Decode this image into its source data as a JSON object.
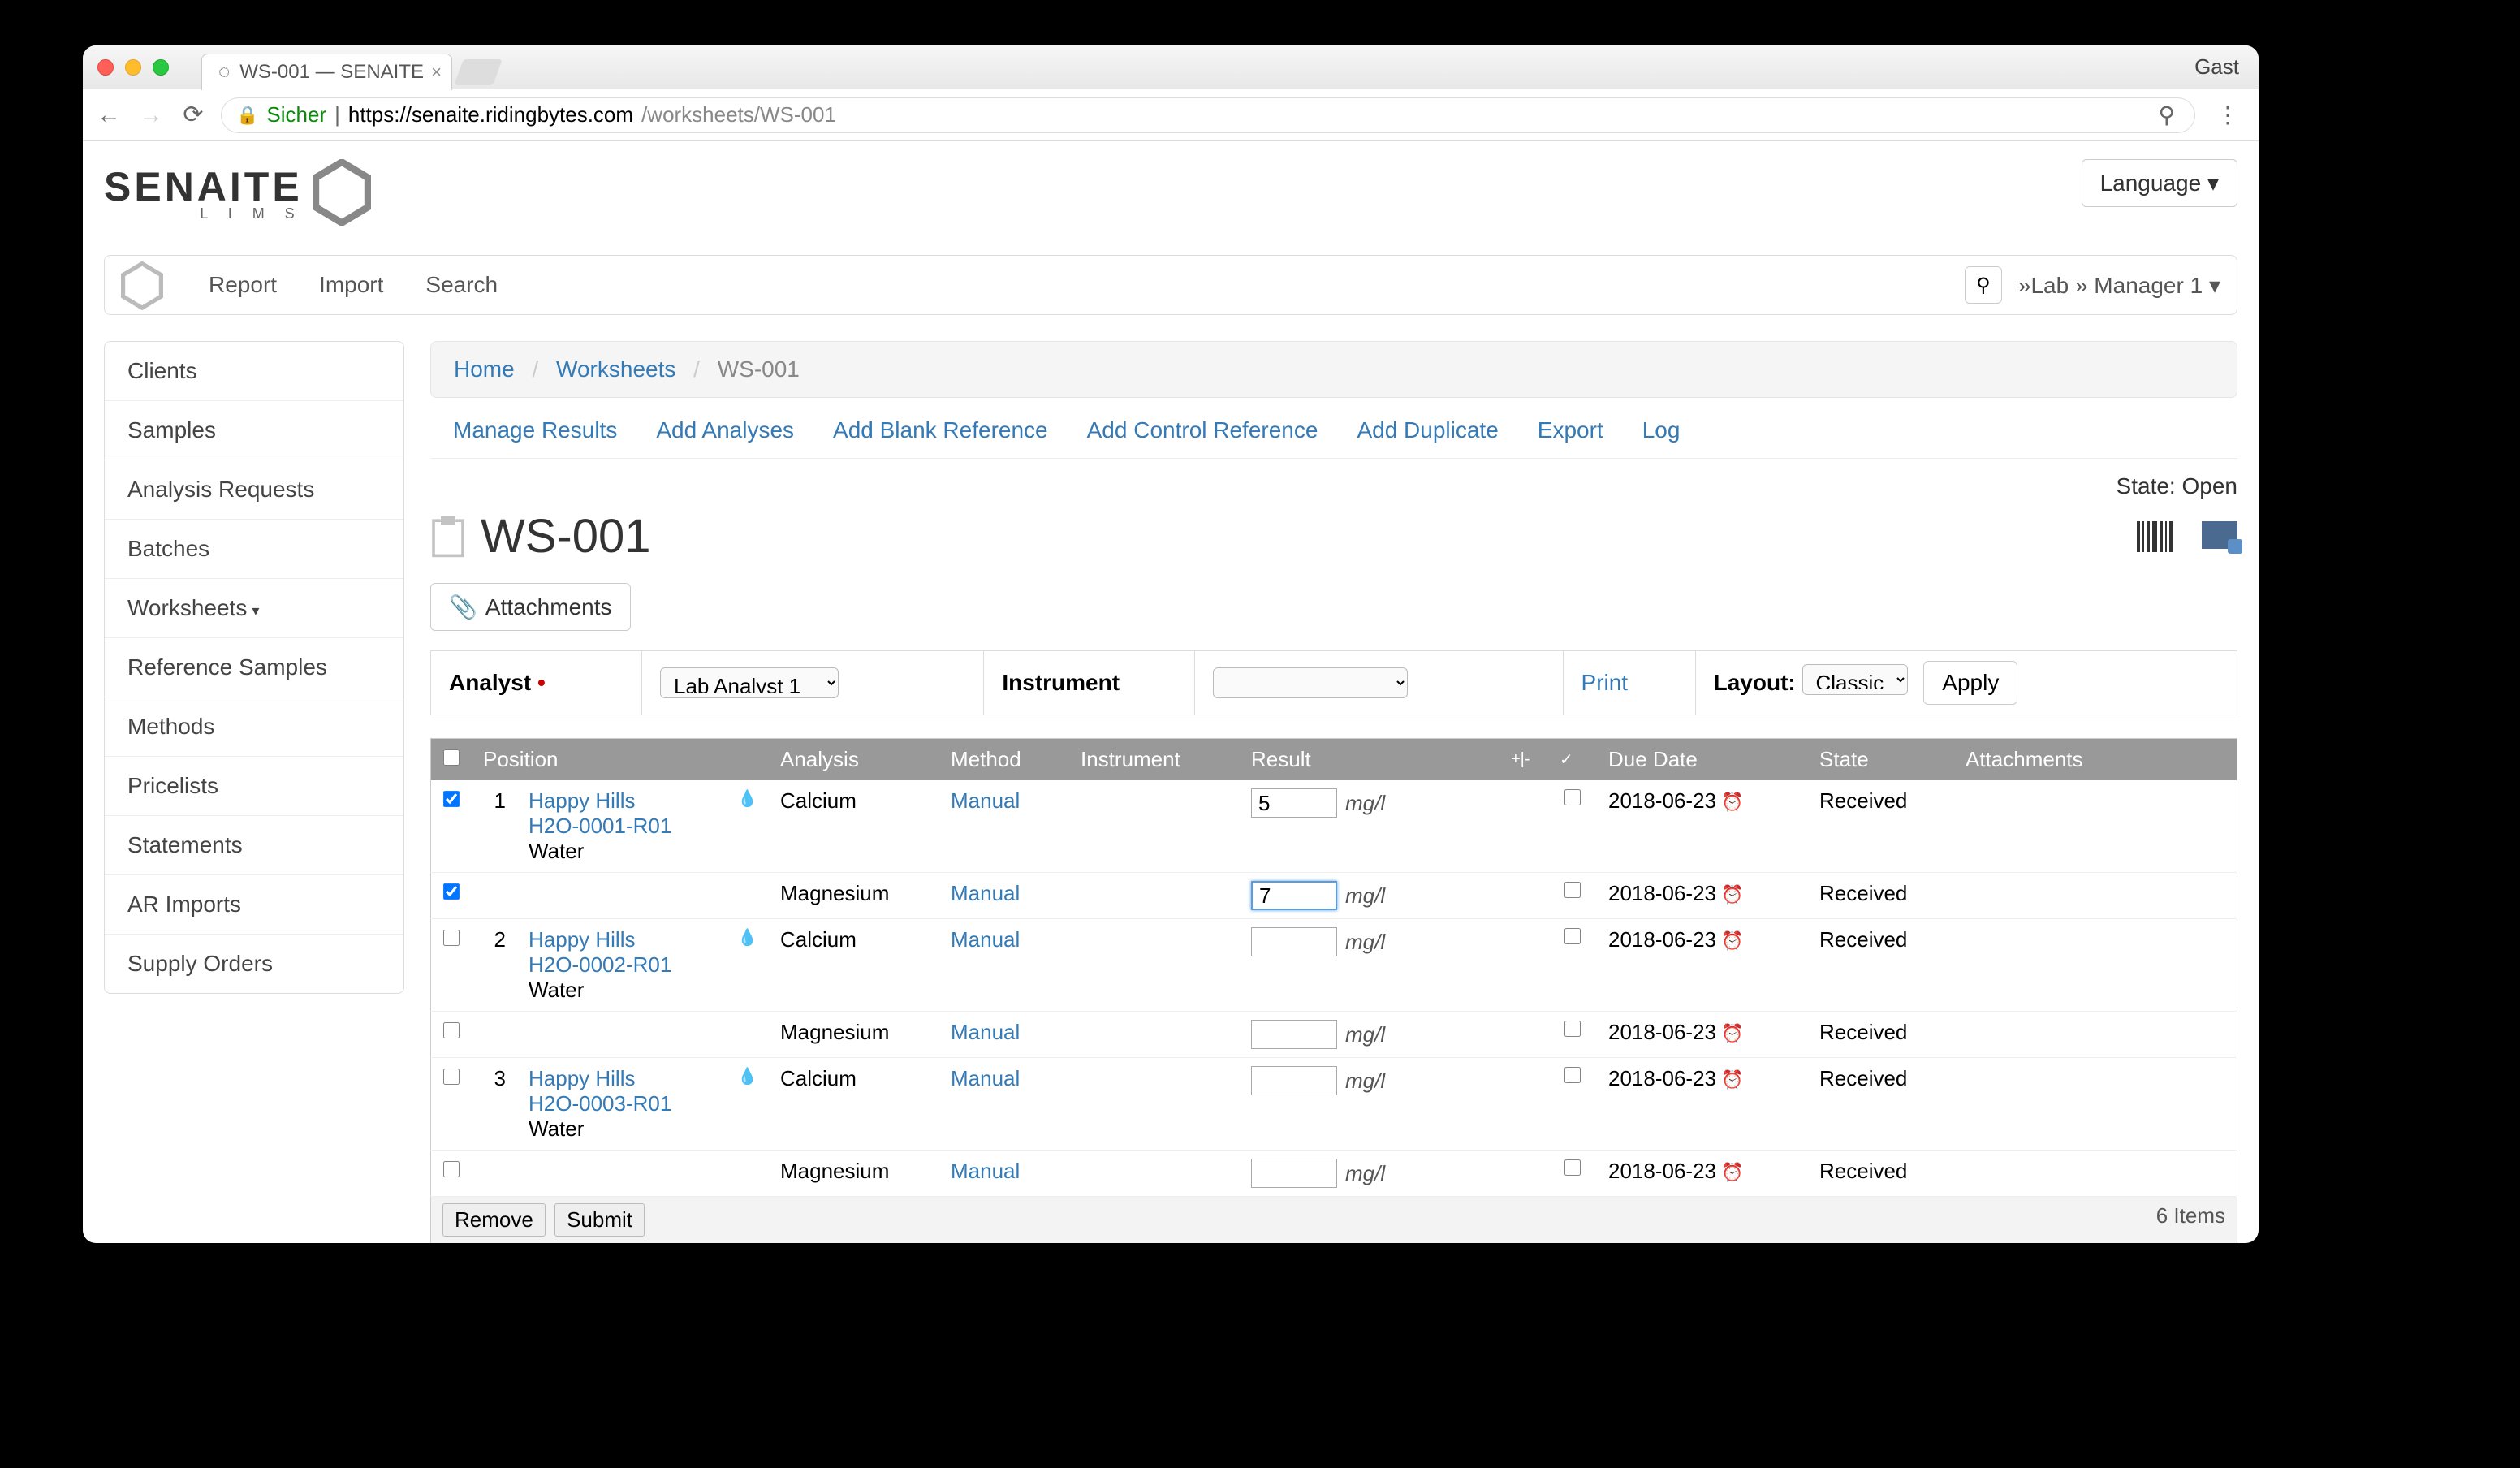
{
  "browser": {
    "tab_title": "WS-001 — SENAITE",
    "profile": "Gast",
    "secure_label": "Sicher",
    "url_host": "https://senaite.ridingbytes.com",
    "url_path": "/worksheets/WS-001"
  },
  "header": {
    "logo_text": "SENAITE",
    "logo_sub": "L I M S",
    "language_btn": "Language"
  },
  "navbar": {
    "links": [
      "Report",
      "Import",
      "Search"
    ],
    "user": "»Lab » Manager 1"
  },
  "sidebar": {
    "items": [
      "Clients",
      "Samples",
      "Analysis Requests",
      "Batches",
      "Worksheets",
      "Reference Samples",
      "Methods",
      "Pricelists",
      "Statements",
      "AR Imports",
      "Supply Orders"
    ]
  },
  "breadcrumb": {
    "home": "Home",
    "worksheets": "Worksheets",
    "current": "WS-001"
  },
  "action_tabs": [
    "Manage Results",
    "Add Analyses",
    "Add Blank Reference",
    "Add Control Reference",
    "Add Duplicate",
    "Export",
    "Log"
  ],
  "state_label": "State:",
  "state_value": "Open",
  "page_title": "WS-001",
  "attachments_btn": "Attachments",
  "controls": {
    "analyst_label": "Analyst",
    "analyst_value": "Lab Analyst 1",
    "instrument_label": "Instrument",
    "instrument_value": "",
    "print": "Print",
    "layout_label": "Layout:",
    "layout_value": "Classic",
    "apply": "Apply"
  },
  "table": {
    "headers": {
      "position": "Position",
      "analysis": "Analysis",
      "method": "Method",
      "instrument": "Instrument",
      "result": "Result",
      "shift": "+|-",
      "tick": "✓",
      "due": "Due Date",
      "state": "State",
      "attachments": "Attachments"
    },
    "rows": [
      {
        "checked": true,
        "pos": "1",
        "client": "Happy Hills",
        "sample_id": "H2O-0001-R01",
        "type": "Water",
        "analysis": "Calcium",
        "method": "Manual",
        "result": "5",
        "unit": "mg/l",
        "due": "2018-06-23",
        "state": "Received",
        "active": false
      },
      {
        "checked": true,
        "pos": "",
        "client": "",
        "sample_id": "",
        "type": "",
        "analysis": "Magnesium",
        "method": "Manual",
        "result": "7",
        "unit": "mg/l",
        "due": "2018-06-23",
        "state": "Received",
        "active": true
      },
      {
        "checked": false,
        "pos": "2",
        "client": "Happy Hills",
        "sample_id": "H2O-0002-R01",
        "type": "Water",
        "analysis": "Calcium",
        "method": "Manual",
        "result": "",
        "unit": "mg/l",
        "due": "2018-06-23",
        "state": "Received",
        "active": false
      },
      {
        "checked": false,
        "pos": "",
        "client": "",
        "sample_id": "",
        "type": "",
        "analysis": "Magnesium",
        "method": "Manual",
        "result": "",
        "unit": "mg/l",
        "due": "2018-06-23",
        "state": "Received",
        "active": false
      },
      {
        "checked": false,
        "pos": "3",
        "client": "Happy Hills",
        "sample_id": "H2O-0003-R01",
        "type": "Water",
        "analysis": "Calcium",
        "method": "Manual",
        "result": "",
        "unit": "mg/l",
        "due": "2018-06-23",
        "state": "Received",
        "active": false
      },
      {
        "checked": false,
        "pos": "",
        "client": "",
        "sample_id": "",
        "type": "",
        "analysis": "Magnesium",
        "method": "Manual",
        "result": "",
        "unit": "mg/l",
        "due": "2018-06-23",
        "state": "Received",
        "active": false
      }
    ],
    "remove": "Remove",
    "submit": "Submit",
    "items": "6 Items"
  }
}
